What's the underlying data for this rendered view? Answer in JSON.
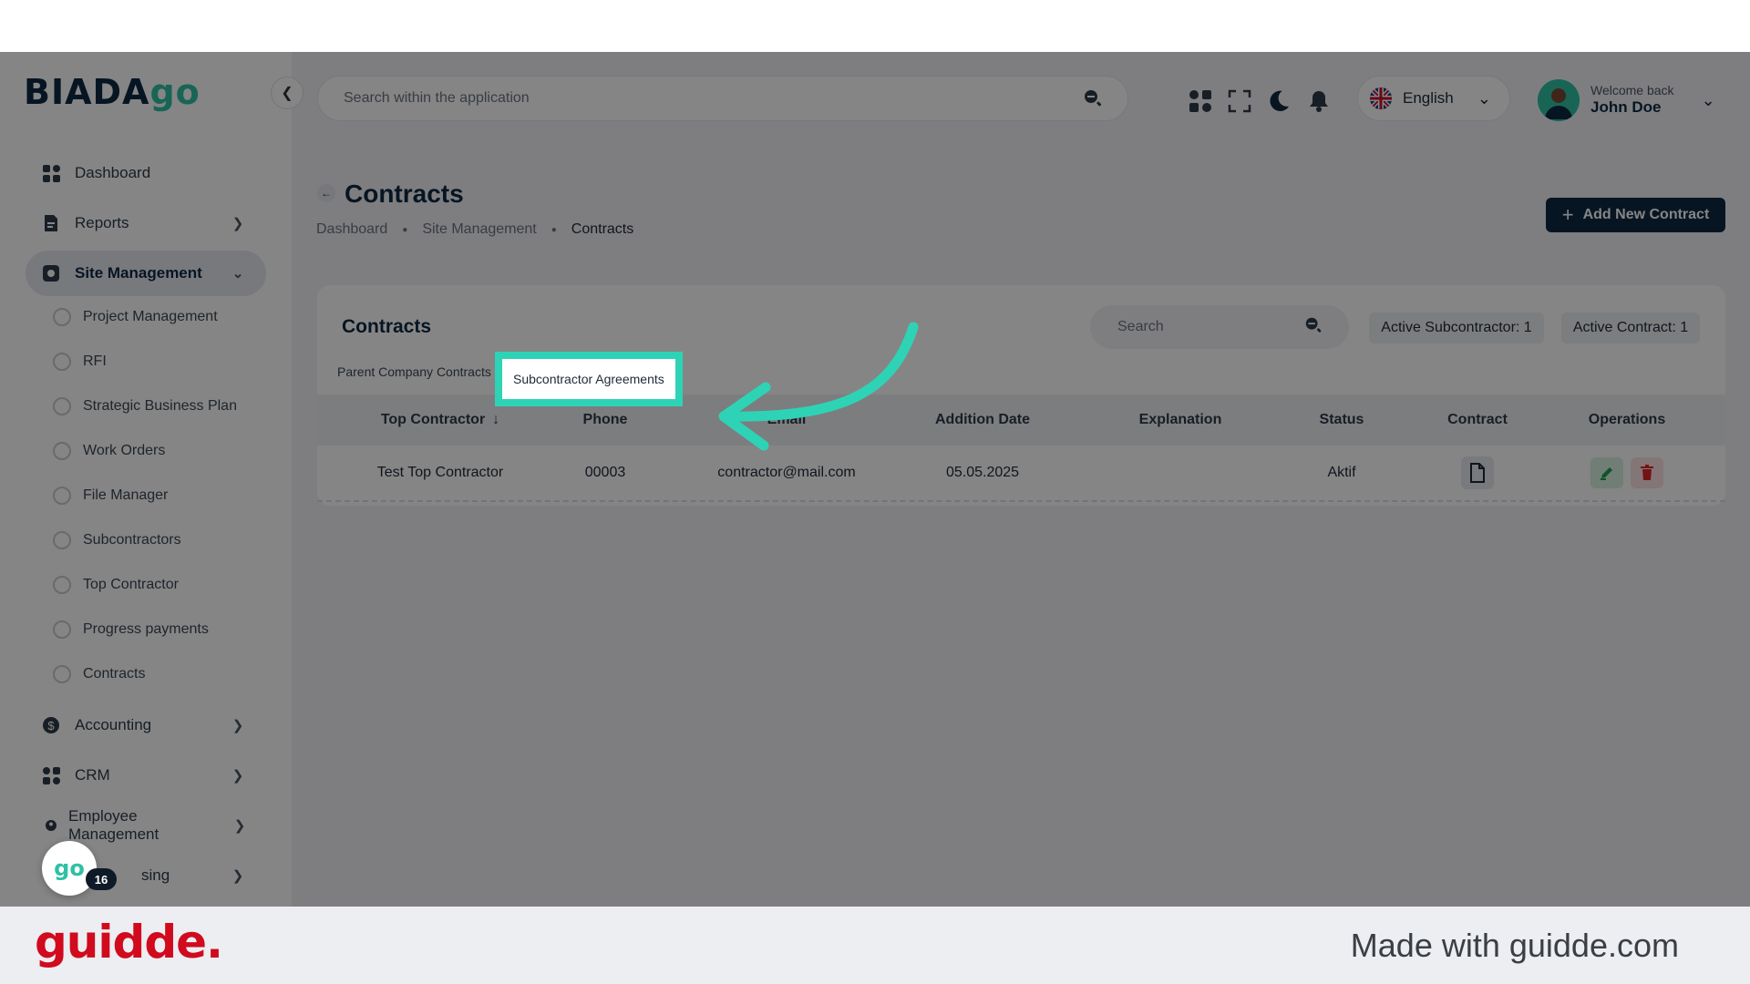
{
  "brand": {
    "name_prefix": "BIADA",
    "name_suffix": "go"
  },
  "header": {
    "search_placeholder": "Search within the application",
    "language": "English",
    "user": {
      "welcome": "Welcome back",
      "name": "John Doe"
    }
  },
  "sidebar": {
    "items": [
      {
        "label": "Dashboard",
        "icon": "grid-icon"
      },
      {
        "label": "Reports",
        "icon": "report-icon"
      },
      {
        "label": "Site Management",
        "icon": "site-icon"
      },
      {
        "label": "Accounting",
        "icon": "dollar-icon"
      },
      {
        "label": "CRM",
        "icon": "grid-icon"
      },
      {
        "label": "Employee Management",
        "icon": "person-icon"
      },
      {
        "label": "Leasing",
        "icon": "lease-icon",
        "visible_text": "sing"
      }
    ],
    "sub_items": [
      "Project Management",
      "RFI",
      "Strategic Business Plan",
      "Work Orders",
      "File Manager",
      "Subcontractors",
      "Top Contractor",
      "Progress payments",
      "Contracts"
    ]
  },
  "page": {
    "title": "Contracts",
    "breadcrumb": [
      "Dashboard",
      "Site Management",
      "Contracts"
    ],
    "add_button": "Add New Contract"
  },
  "card": {
    "title": "Contracts",
    "search_placeholder": "Search",
    "pills": [
      "Active Subcontractor: 1",
      "Active Contract: 1"
    ],
    "tabs": [
      "Parent Company Contracts",
      "Subcontractor Agreements"
    ],
    "columns": [
      "Top Contractor",
      "Phone",
      "Email",
      "Addition Date",
      "Explanation",
      "Status",
      "Contract",
      "Operations"
    ],
    "rows": [
      {
        "top_contractor": "Test Top Contractor",
        "phone": "00003",
        "email": "contractor@mail.com",
        "addition_date": "05.05.2025",
        "explanation": "",
        "status": "Aktif"
      }
    ]
  },
  "widget": {
    "logo": "go",
    "badge": "16"
  },
  "footer": {
    "logo": "guidde.",
    "made_with": "Made with guidde.com"
  },
  "colors": {
    "accent": "#2ed3b6",
    "brand_dark": "#0e2a44",
    "brand_green": "#2ec1a6",
    "guidde_red": "#d10a1e"
  }
}
